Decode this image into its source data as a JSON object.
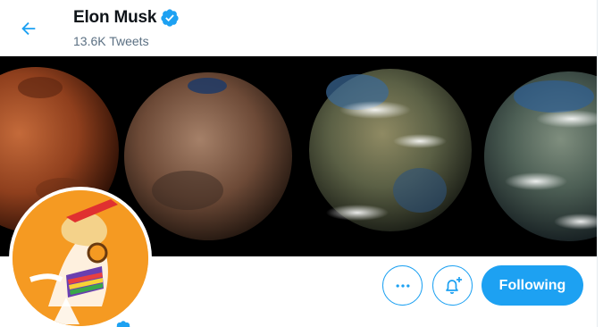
{
  "header": {
    "name": "Elon Musk",
    "tweet_count": "13.6K Tweets"
  },
  "actions": {
    "following_label": "Following"
  },
  "colors": {
    "accent": "#1da1f2",
    "banner_bg": "#000000",
    "avatar_bg": "#f59a22"
  },
  "icons": {
    "back": "back-arrow-icon",
    "verified": "verified-badge-icon",
    "more": "more-dots-icon",
    "notify": "bell-plus-icon"
  }
}
